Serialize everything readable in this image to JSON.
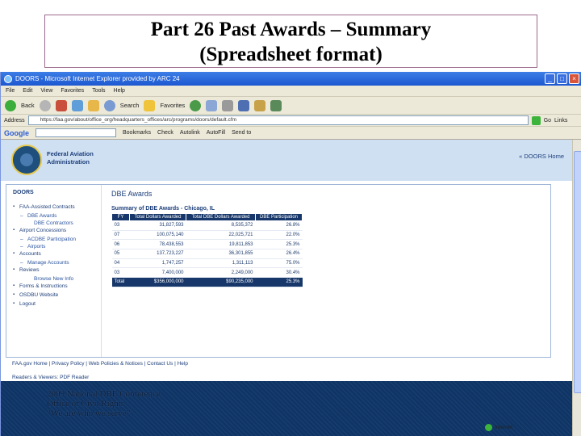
{
  "slide": {
    "title_line1": "Part 26 Past Awards – Summary",
    "title_line2": "(Spreadsheet format)"
  },
  "browser": {
    "window_title": "DOORS - Microsoft Internet Explorer provided by ARC 24",
    "menu": [
      "File",
      "Edit",
      "View",
      "Favorites",
      "Tools",
      "Help"
    ],
    "back_label": "Back",
    "search_label": "Search",
    "favorites_label": "Favorites",
    "address_label": "Address",
    "address_url": "https://faa.gov/about/office_org/headquarters_offices/arc/programs/doors/default.cfm",
    "go_label": "Go",
    "links_label": "Links",
    "google_label": "Google",
    "google_items": [
      "Bookmarks",
      "Check",
      "Autolink",
      "AutoFill",
      "Send to"
    ],
    "status_zone": "Internet"
  },
  "page": {
    "agency_line1": "Federal Aviation",
    "agency_line2": "Administration",
    "doors_home": "« DOORS Home",
    "sidebar": {
      "title": "DOORS",
      "items": [
        {
          "label": "FAA-Assisted Contracts",
          "subs": [
            {
              "label": "DBE Awards",
              "subsub": "DBE Contractors"
            }
          ]
        },
        {
          "label": "Airport Concessions",
          "subs": [
            {
              "label": "ACDBE Participation"
            },
            {
              "label": "Airports"
            }
          ]
        },
        {
          "label": "Accounts",
          "subs": [
            {
              "label": "Manage Accounts"
            }
          ]
        },
        {
          "label": "Reviews",
          "subsub": "Browse New Info"
        },
        {
          "label": "Forms & Instructions"
        },
        {
          "label": "OSDBU Website"
        },
        {
          "label": "Logout"
        }
      ]
    },
    "main_title": "DBE Awards",
    "summary_title": "Summary of DBE Awards - Chicago, IL",
    "table": {
      "headers": [
        "FY",
        "Total Dollars Awarded",
        "Total DBE Dollars Awarded",
        "DBE Participation"
      ],
      "rows": [
        [
          "03",
          "31,827,593",
          "8,535,372",
          "26.8%"
        ],
        [
          "07",
          "100,075,140",
          "22,025,721",
          "22.0%"
        ],
        [
          "06",
          "78,438,553",
          "19,811,853",
          "25.3%"
        ],
        [
          "05",
          "137,723,227",
          "36,301,855",
          "26.4%"
        ],
        [
          "04",
          "1,747,257",
          "1,311,113",
          "75.0%"
        ],
        [
          "03",
          "7,400,000",
          "2,249,000",
          "30.4%"
        ]
      ],
      "total": [
        "Total",
        "$356,000,000",
        "$90,235,000",
        "25.3%"
      ]
    },
    "footer_links": "FAA.gov Home | Privacy Policy | Web Policies & Notices | Contact Us | Help",
    "readers_viewers": "Readers & Viewers: PDF Reader",
    "conference": {
      "line1": "2009 National DBE Conference",
      "line2": "Office of Civil Rights",
      "line3": "“We are who we serve”"
    }
  }
}
